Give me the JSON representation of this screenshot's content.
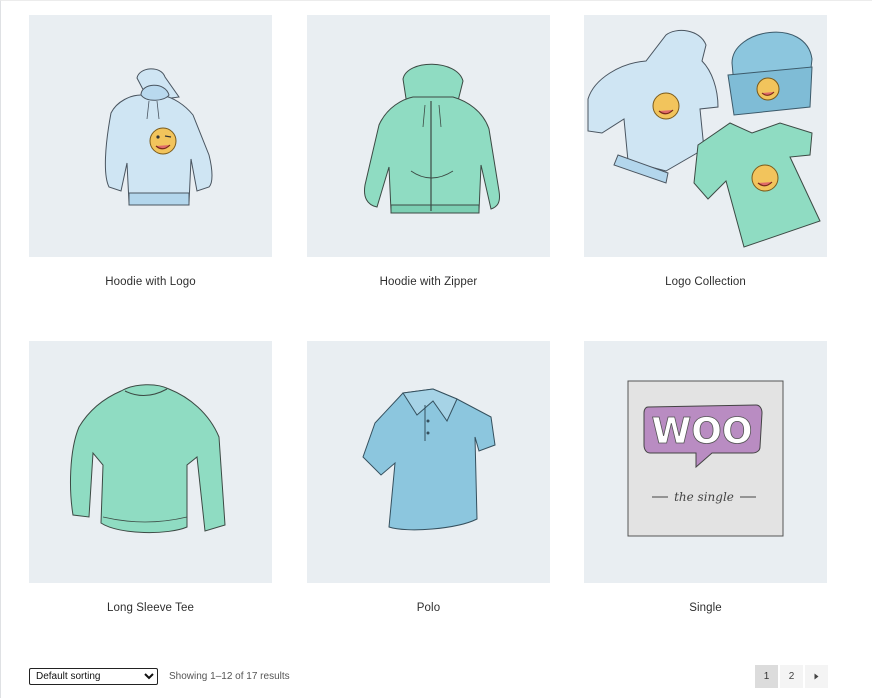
{
  "products": [
    {
      "name": "Hoodie with Logo"
    },
    {
      "name": "Hoodie with Zipper"
    },
    {
      "name": "Logo Collection"
    },
    {
      "name": "Long Sleeve Tee"
    },
    {
      "name": "Polo"
    },
    {
      "name": "Single"
    }
  ],
  "toolbar": {
    "sort_selected": "Default sorting",
    "result_count": "Showing 1–12 of 17 results"
  },
  "pagination": {
    "pages": [
      "1",
      "2"
    ],
    "current": "1",
    "next_icon": "next-arrow-icon"
  },
  "single_art": {
    "logo_text": "WOO",
    "caption": "the single"
  },
  "colors": {
    "thumb_bg": "#e9eef2",
    "mint": "#7fd4b8",
    "light_blue": "#c8e2f0",
    "blue": "#8cc6de",
    "woo_purple": "#b98cc2"
  }
}
